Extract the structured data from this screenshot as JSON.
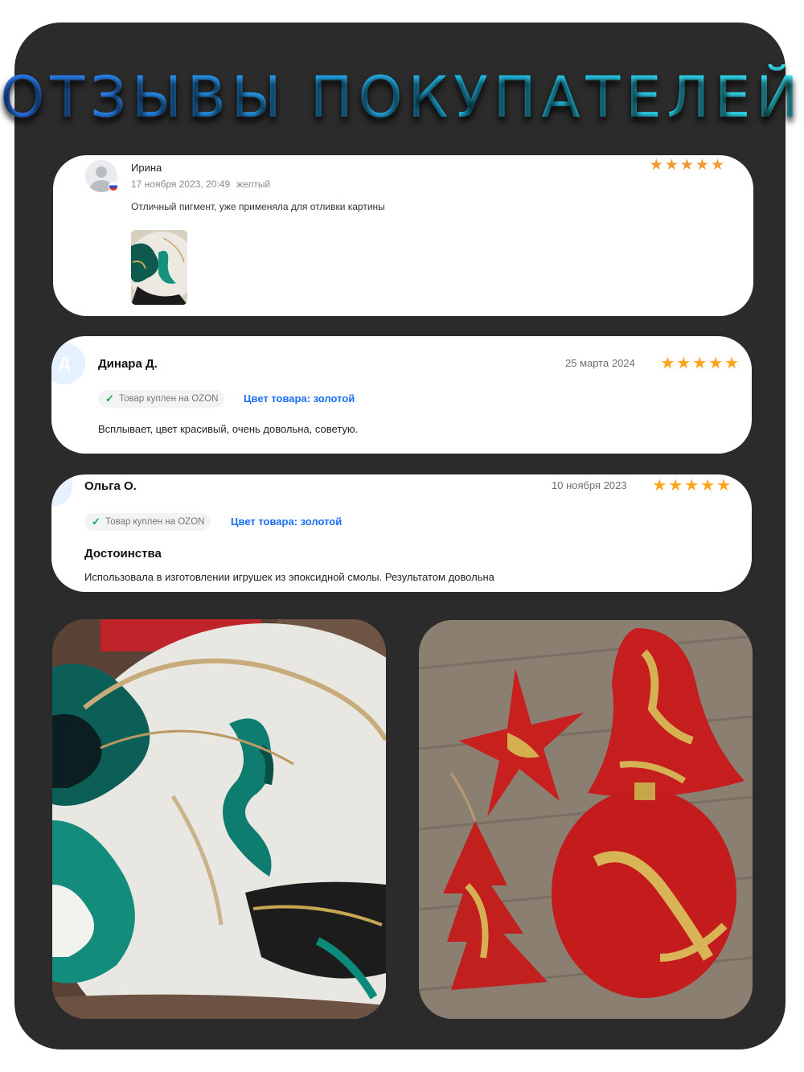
{
  "header": {
    "title": "ОТЗЫВЫ ПОКУПАТЕЛЕЙ"
  },
  "reviews": [
    {
      "name": "Ирина",
      "date": "17 ноября 2023, 20:49",
      "variant": "желтый",
      "text": "Отличный пигмент, уже применяла для отливки картины",
      "rating": 5,
      "avatar_icon": "user-avatar-icon",
      "flag_icon": "russia-flag-icon"
    },
    {
      "initial": "Д",
      "name": "Динара Д.",
      "date": "25 марта 2024",
      "badge": "Товар куплен на OZON",
      "color": "Цвет товара: золотой",
      "text": "Всплывает, цвет красивый, очень довольна, советую.",
      "rating": 5
    },
    {
      "name": "Ольга О.",
      "date": "10 ноября 2023",
      "badge": "Товар куплен на OZON",
      "color": "Цвет товара: золотой",
      "section_title": "Достоинства",
      "text": "Использовала в изготовлении игрушек из эпоксидной смолы. Результатом довольна",
      "rating": 5
    }
  ],
  "colors": {
    "background_panel": "#2b2b2b",
    "star": "#ffa31a",
    "link": "#1a6ef5",
    "check": "#12a84a"
  },
  "icons": {
    "star": "★",
    "check": "✓"
  }
}
